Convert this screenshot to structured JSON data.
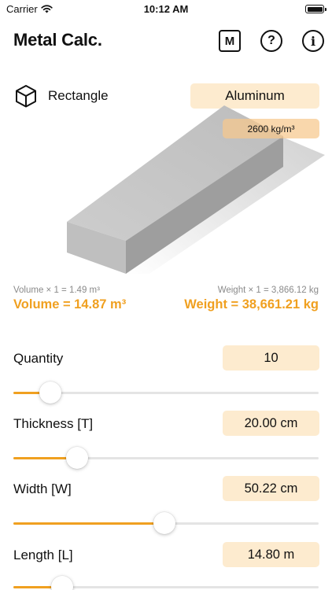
{
  "status_bar": {
    "carrier": "Carrier",
    "time": "10:12 AM"
  },
  "nav": {
    "title": "Metal Calc.",
    "m_button": "M",
    "help_button": "?",
    "info_button": "i"
  },
  "shape": {
    "label": "Rectangle",
    "icon": "cube-outline-icon"
  },
  "material": {
    "name": "Aluminum",
    "density": "2600 kg/m³"
  },
  "results": {
    "volume_single": "Volume × 1 = 1.49 m³",
    "volume_total": "Volume = 14.87 m³",
    "weight_single": "Weight × 1 = 3,866.12 kg",
    "weight_total": "Weight = 38,661.21 kg"
  },
  "colors": {
    "accent": "#f0a020",
    "pill": "#fdebcf",
    "track": "#e4e4e4"
  },
  "parameters": [
    {
      "id": "quantity",
      "label": "Quantity",
      "value": "10",
      "slider_fraction": 0.12
    },
    {
      "id": "thickness",
      "label": "Thickness [T]",
      "value": "20.00 cm",
      "slider_fraction": 0.21
    },
    {
      "id": "width",
      "label": "Width [W]",
      "value": "50.22 cm",
      "slider_fraction": 0.495
    },
    {
      "id": "length",
      "label": "Length [L]",
      "value": "14.80 m",
      "slider_fraction": 0.16
    }
  ]
}
